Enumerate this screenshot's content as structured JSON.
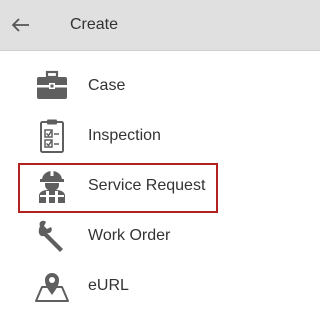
{
  "header": {
    "title": "Create",
    "back_icon": "arrow-left-icon"
  },
  "menu": {
    "items": [
      {
        "label": "Case",
        "icon": "briefcase-icon"
      },
      {
        "label": "Inspection",
        "icon": "clipboard-checklist-icon"
      },
      {
        "label": "Service Request",
        "icon": "worker-hardhat-icon",
        "selected": true
      },
      {
        "label": "Work Order",
        "icon": "wrench-icon"
      },
      {
        "label": "eURL",
        "icon": "map-pin-icon"
      }
    ]
  },
  "colors": {
    "header_bg": "#e0e0e0",
    "icon": "#5f5f5f",
    "selection_border": "#b22222"
  }
}
